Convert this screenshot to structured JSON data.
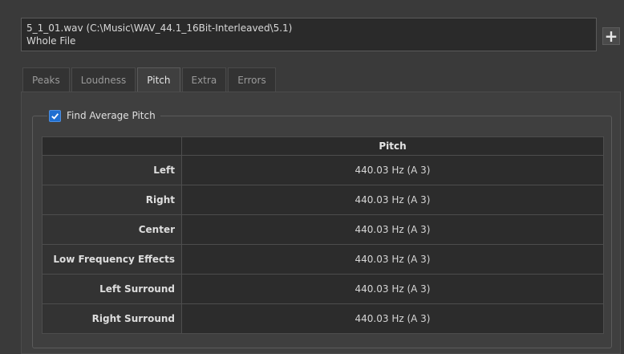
{
  "file": {
    "line1": "5_1_01.wav (C:\\Music\\WAV_44.1_16Bit-Interleaved\\5.1)",
    "line2": "Whole File"
  },
  "add_button_label": "+",
  "tabs": [
    {
      "label": "Peaks",
      "active": false
    },
    {
      "label": "Loudness",
      "active": false
    },
    {
      "label": "Pitch",
      "active": true
    },
    {
      "label": "Extra",
      "active": false
    },
    {
      "label": "Errors",
      "active": false
    }
  ],
  "group": {
    "checkbox_checked": true,
    "label": "Find Average Pitch"
  },
  "table": {
    "column_header": "Pitch",
    "rows": [
      {
        "channel": "Left",
        "pitch": "440.03 Hz (A 3)"
      },
      {
        "channel": "Right",
        "pitch": "440.03 Hz (A 3)"
      },
      {
        "channel": "Center",
        "pitch": "440.03 Hz (A 3)"
      },
      {
        "channel": "Low Frequency Effects",
        "pitch": "440.03 Hz (A 3)"
      },
      {
        "channel": "Left Surround",
        "pitch": "440.03 Hz (A 3)"
      },
      {
        "channel": "Right Surround",
        "pitch": "440.03 Hz (A 3)"
      }
    ]
  },
  "colors": {
    "background": "#3a3a3a",
    "checkbox_accent": "#1f6fd1"
  }
}
